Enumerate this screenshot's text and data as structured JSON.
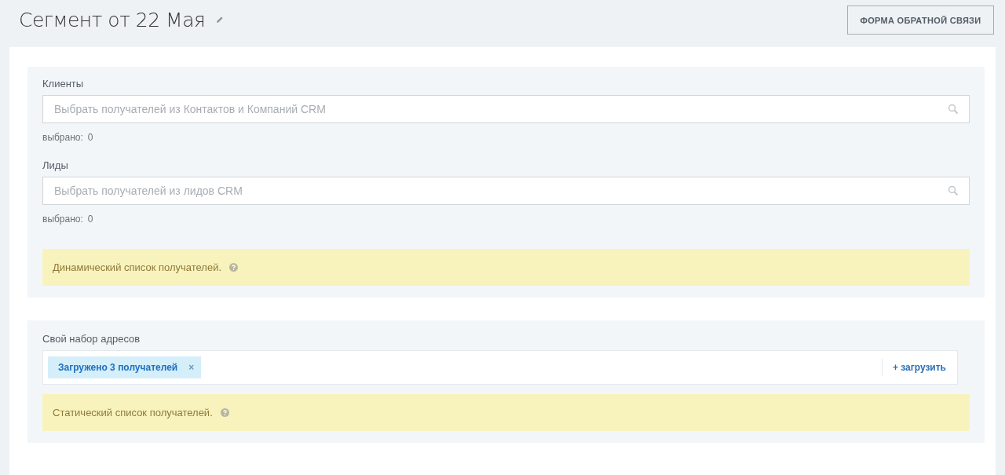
{
  "header": {
    "title": "Сегмент от 22 Мая",
    "feedback_button": "ФОРМА ОБРАТНОЙ СВЯЗИ"
  },
  "dynamic_section": {
    "fields": [
      {
        "label": "Клиенты",
        "placeholder": "Выбрать получателей из Контактов и Компаний CRM",
        "selected_label": "выбрано:",
        "selected_count": "0"
      },
      {
        "label": "Лиды",
        "placeholder": "Выбрать получателей из лидов CRM",
        "selected_label": "выбрано:",
        "selected_count": "0"
      }
    ],
    "notice": "Динамический список получателей."
  },
  "static_section": {
    "label": "Свой набор адресов",
    "tags": [
      {
        "text": "Загружено 3 получателей",
        "remove": "×"
      }
    ],
    "upload_link": "+ загрузить",
    "notice": "Статический список получателей."
  }
}
